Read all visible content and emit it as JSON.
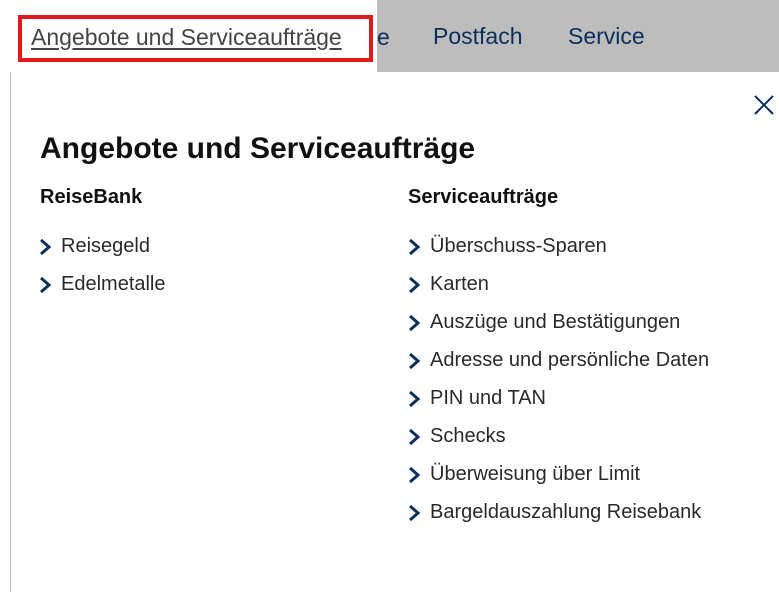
{
  "nav": {
    "active": "Angebote und Serviceaufträge",
    "truncated_fragment": "e",
    "postfach": "Postfach",
    "service": "Service"
  },
  "panel": {
    "title": "Angebote und Serviceaufträge",
    "close_label": "×"
  },
  "columns": {
    "left": {
      "heading": "ReiseBank",
      "items": [
        {
          "label": "Reisegeld"
        },
        {
          "label": "Edelmetalle"
        }
      ]
    },
    "right": {
      "heading": "Serviceaufträge",
      "items": [
        {
          "label": "Überschuss-Sparen"
        },
        {
          "label": "Karten"
        },
        {
          "label": "Auszüge und Bestätigungen"
        },
        {
          "label": "Adresse und persönliche Daten"
        },
        {
          "label": "PIN und TAN"
        },
        {
          "label": "Schecks"
        },
        {
          "label": "Überweisung über Limit"
        },
        {
          "label": "Bargeldauszahlung Reisebank"
        }
      ]
    }
  },
  "icons": {
    "link_chevron": "chevron-right-icon",
    "close": "close-icon"
  },
  "colors": {
    "nav_text": "#0a2f5c",
    "highlight_frame": "#e0191f",
    "nav_bar": "#bdbdbd"
  }
}
